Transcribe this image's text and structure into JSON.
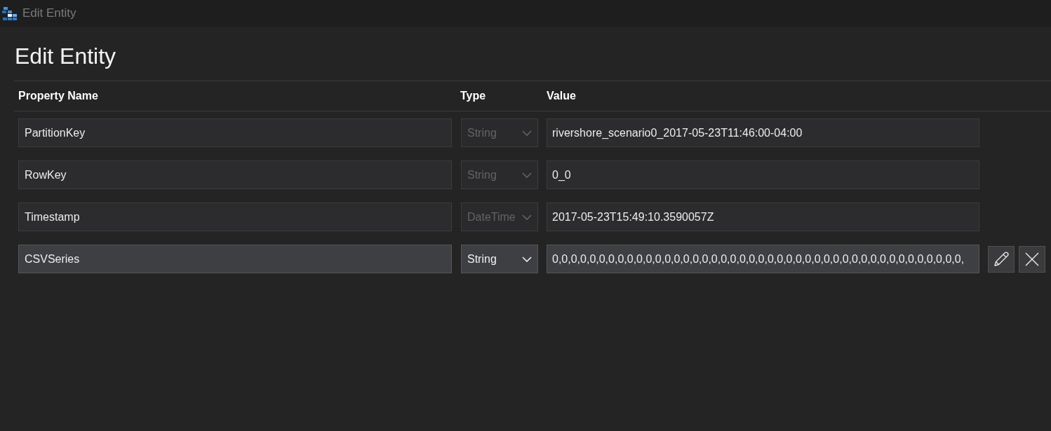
{
  "window": {
    "title": "Edit Entity"
  },
  "heading": "Edit Entity",
  "table": {
    "columns": [
      "Property Name",
      "Type",
      "Value"
    ],
    "rows": [
      {
        "name": "PartitionKey",
        "type": "String",
        "type_disabled": true,
        "value": "rivershore_scenario0_2017-05-23T11:46:00-04:00",
        "selected": false
      },
      {
        "name": "RowKey",
        "type": "String",
        "type_disabled": true,
        "value": "0_0",
        "selected": false
      },
      {
        "name": "Timestamp",
        "type": "DateTime",
        "type_disabled": true,
        "value": "2017-05-23T15:49:10.3590057Z",
        "selected": false
      },
      {
        "name": "CSVSeries",
        "type": "String",
        "type_disabled": false,
        "value": "0,0,0,0,0,0,0,0,0,0,0,0,0,0,0,0,0,0,0,0,0,0,0,0,0,0,0,0,0,0,0,0,0,0,0,0,0,0,0,0,0,0,0,0,",
        "selected": true
      }
    ]
  }
}
